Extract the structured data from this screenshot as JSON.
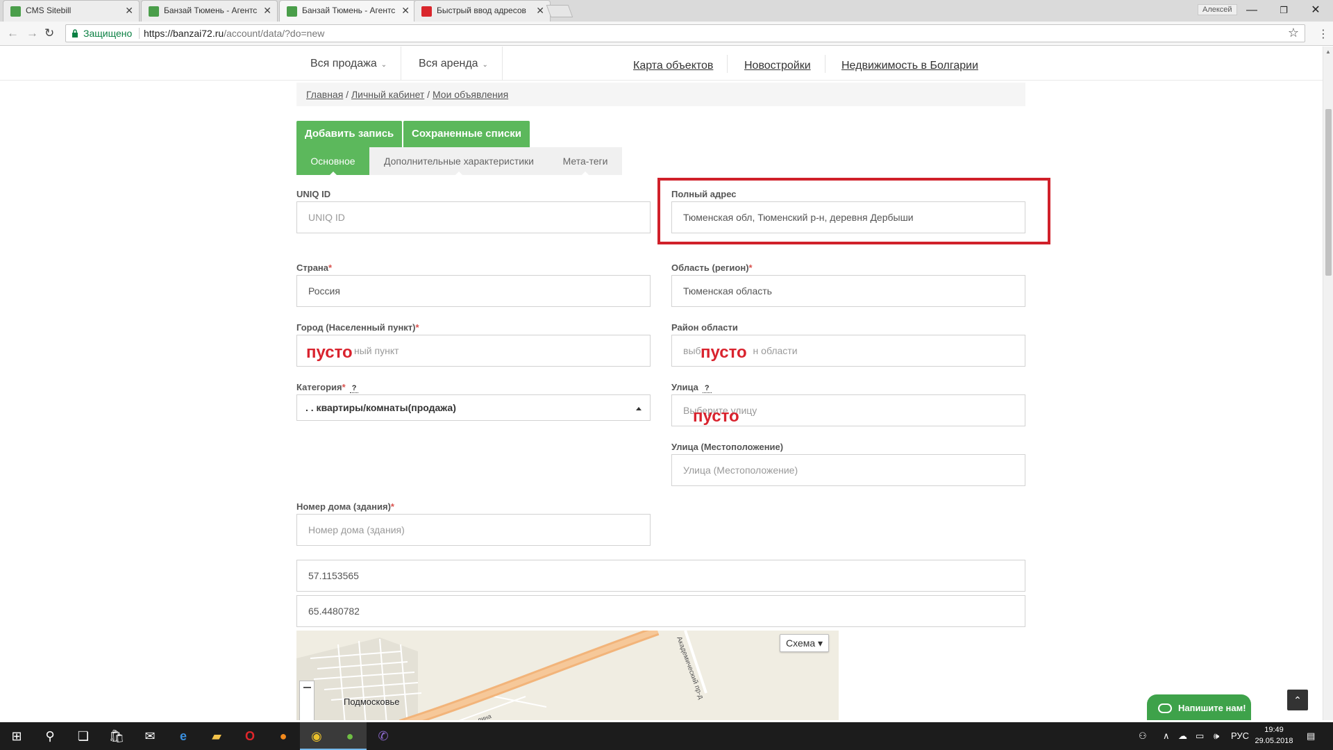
{
  "browser": {
    "tabs": [
      {
        "label": "CMS Sitebill",
        "favicon_color": "#4a9e4a"
      },
      {
        "label": "Банзай Тюмень - Агентс",
        "favicon_color": "#4a9e4a"
      },
      {
        "label": "Банзай Тюмень - Агентс",
        "favicon_color": "#4a9e4a"
      },
      {
        "label": "Быстрый ввод адресов",
        "favicon_color": "#d9262c"
      }
    ],
    "user": "Алексей",
    "secure_label": "Защищено",
    "url_prefix": "https://banzai72.ru",
    "url_path": "/account/data/?do=new"
  },
  "nav": {
    "sale": "Вся продажа",
    "rent": "Вся аренда",
    "links": [
      "Карта объектов",
      "Новостройки",
      "Недвижимость в Болгарии"
    ]
  },
  "breadcrumb": [
    "Главная",
    "Личный кабинет",
    "Мои объявления"
  ],
  "buttons": {
    "add": "Добавить запись",
    "saved": "Сохраненные списки"
  },
  "tabs": [
    "Основное",
    "Дополнительные характеристики",
    "Мета-теги"
  ],
  "form": {
    "uniq_id": {
      "label": "UNIQ ID",
      "placeholder": "UNIQ ID"
    },
    "full_address": {
      "label": "Полный адрес",
      "value": "Тюменская обл, Тюменский р-н, деревня Дербыши"
    },
    "country": {
      "label": "Страна",
      "value": "Россия"
    },
    "region": {
      "label": "Область (регион)",
      "value": "Тюменская область"
    },
    "city": {
      "label": "Город (Населенный пункт)",
      "placeholder": "ный пункт"
    },
    "district": {
      "label": "Район области",
      "placeholder_left": "выб",
      "placeholder_right": "н области"
    },
    "category": {
      "label": "Категория",
      "help": "?",
      "value": ". . квартиры/комнаты(продажа)"
    },
    "street": {
      "label": "Улица",
      "help": "?",
      "placeholder": "Выберите улицу"
    },
    "street_location": {
      "label": "Улица (Местоположение)",
      "placeholder": "Улица (Местоположение)"
    },
    "house": {
      "label": "Номер дома (здания)",
      "placeholder": "Номер дома (здания)"
    },
    "lat": "57.1153565",
    "lng": "65.4480782",
    "required_mark": "*"
  },
  "annotations": {
    "empty": "пусто"
  },
  "map": {
    "schema": "Схема ▾",
    "place_label": "Подмосковье",
    "road_label": "Академический пр-д",
    "road_label2": "лина"
  },
  "chat": {
    "label": "Напишите нам!"
  },
  "taskbar": {
    "lang": "РУС",
    "time": "19:49",
    "date": "29.05.2018"
  },
  "colors": {
    "accent_green": "#5cb85c",
    "highlight_red": "#d0202a",
    "annotation_red": "#d9232e"
  }
}
